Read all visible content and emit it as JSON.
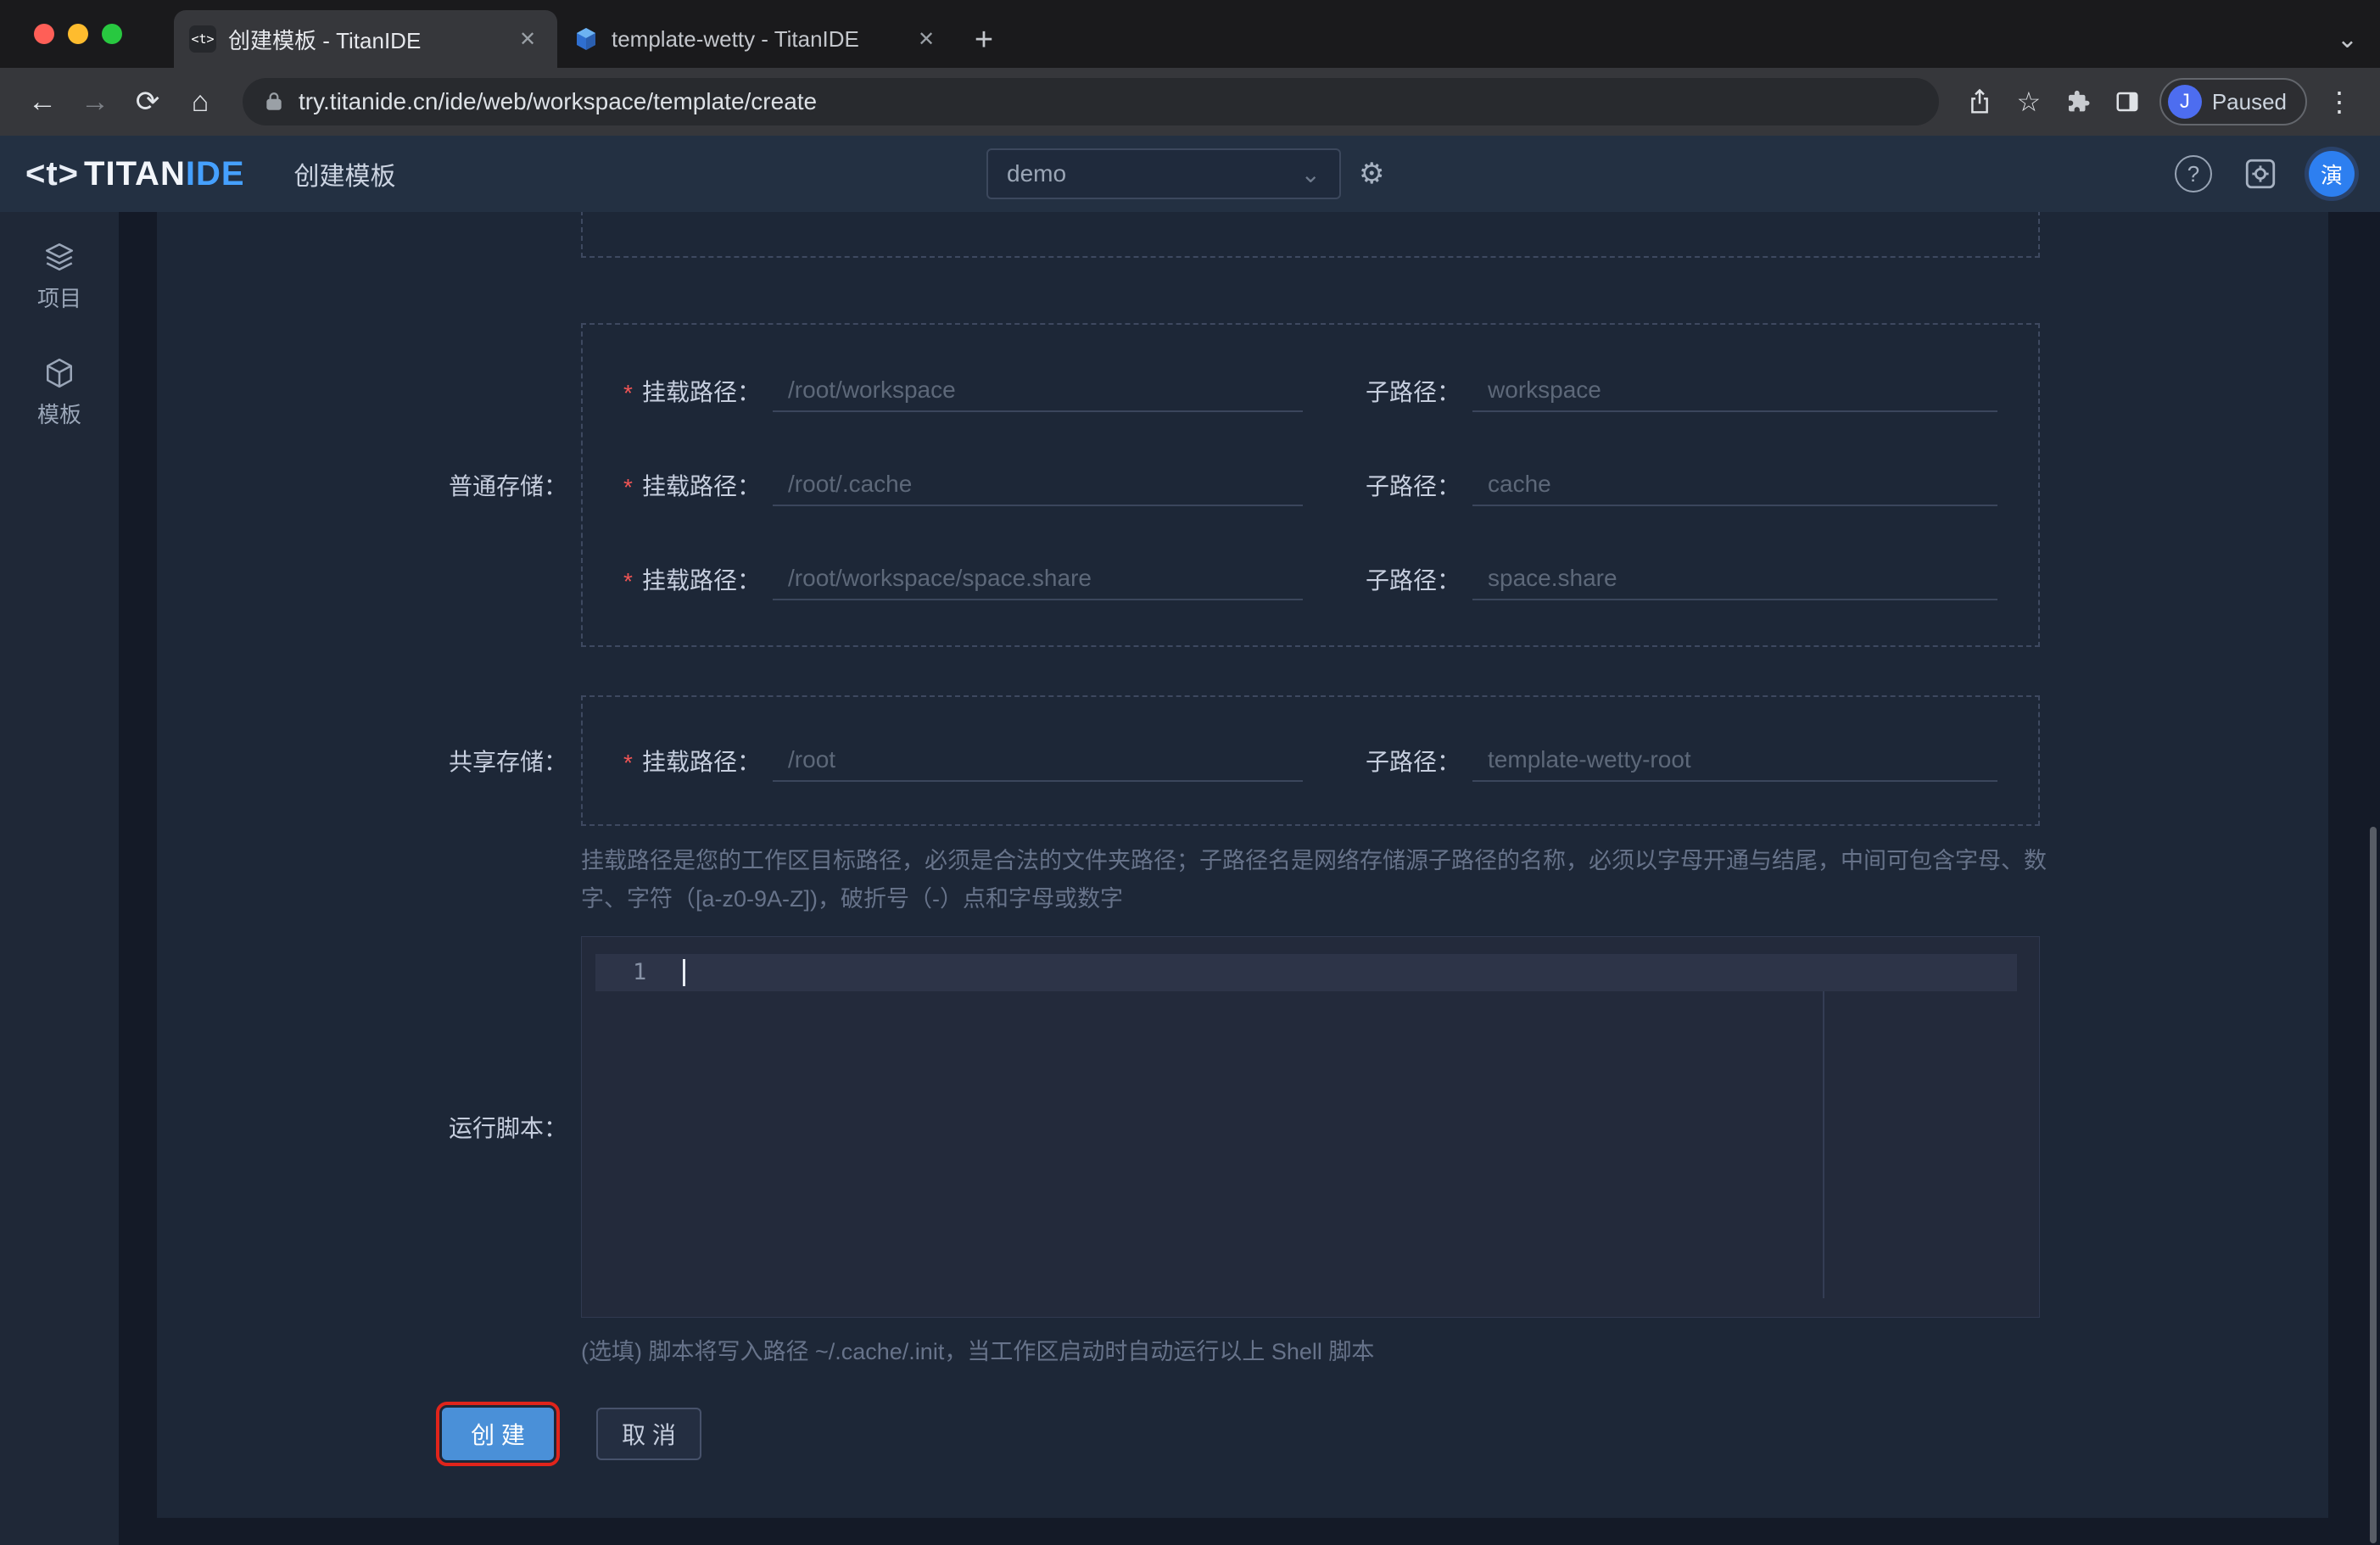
{
  "colors": {
    "accent-blue": "#4a90d8",
    "annotation-red": "#e0241b",
    "avatar-blue": "#2d7ff0",
    "profile-blue": "#4d6df0",
    "logo-blue": "#45a0ff",
    "required-red": "#f05555"
  },
  "browser": {
    "tabs": [
      {
        "title": "创建模板 - TitanIDE",
        "favicon_text": "<t>"
      },
      {
        "title": "template-wetty - TitanIDE"
      }
    ],
    "url": "try.titanide.cn/ide/web/workspace/template/create",
    "profile_initial": "J",
    "profile_label": "Paused"
  },
  "icons": {
    "back": "←",
    "forward": "→",
    "reload": "⟳",
    "home": "⌂",
    "close": "✕",
    "new_tab": "+",
    "tab_search": "⌄",
    "star": "☆",
    "more": "⋮",
    "help": "?",
    "chevron_down": "⌄",
    "gear": "⚙"
  },
  "header": {
    "logo_prefix": "<t>",
    "logo_main": "TITAN",
    "logo_suffix": "IDE",
    "page_title": "创建模板",
    "workspace_value": "demo",
    "avatar_text": "演"
  },
  "sidebar": {
    "items": [
      {
        "label": "项目"
      },
      {
        "label": "模板"
      }
    ]
  },
  "form": {
    "required_mark": "*",
    "normal_storage": {
      "label": "普通存储：",
      "rows": [
        {
          "mount_label": "挂载路径：",
          "mount_placeholder": "/root/workspace",
          "sub_label": "子路径：",
          "sub_placeholder": "workspace"
        },
        {
          "mount_label": "挂载路径：",
          "mount_placeholder": "/root/.cache",
          "sub_label": "子路径：",
          "sub_placeholder": "cache"
        },
        {
          "mount_label": "挂载路径：",
          "mount_placeholder": "/root/workspace/space.share",
          "sub_label": "子路径：",
          "sub_placeholder": "space.share"
        }
      ]
    },
    "shared_storage": {
      "label": "共享存储：",
      "rows": [
        {
          "mount_label": "挂载路径：",
          "mount_placeholder": "/root",
          "sub_label": "子路径：",
          "sub_placeholder": "template-wetty-root"
        }
      ]
    },
    "path_hint": "挂载路径是您的工作区目标路径，必须是合法的文件夹路径；子路径名是网络存储源子路径的名称，必须以字母开通与结尾，中间可包含字母、数字、字符（[a-z0-9A-Z])，破折号（-）点和字母或数字",
    "script_section": {
      "label": "运行脚本：",
      "line_number": "1",
      "hint": "(选填) 脚本将写入路径 ~/.cache/.init，当工作区启动时自动运行以上 Shell 脚本"
    },
    "create_label": "创 建",
    "cancel_label": "取 消"
  }
}
